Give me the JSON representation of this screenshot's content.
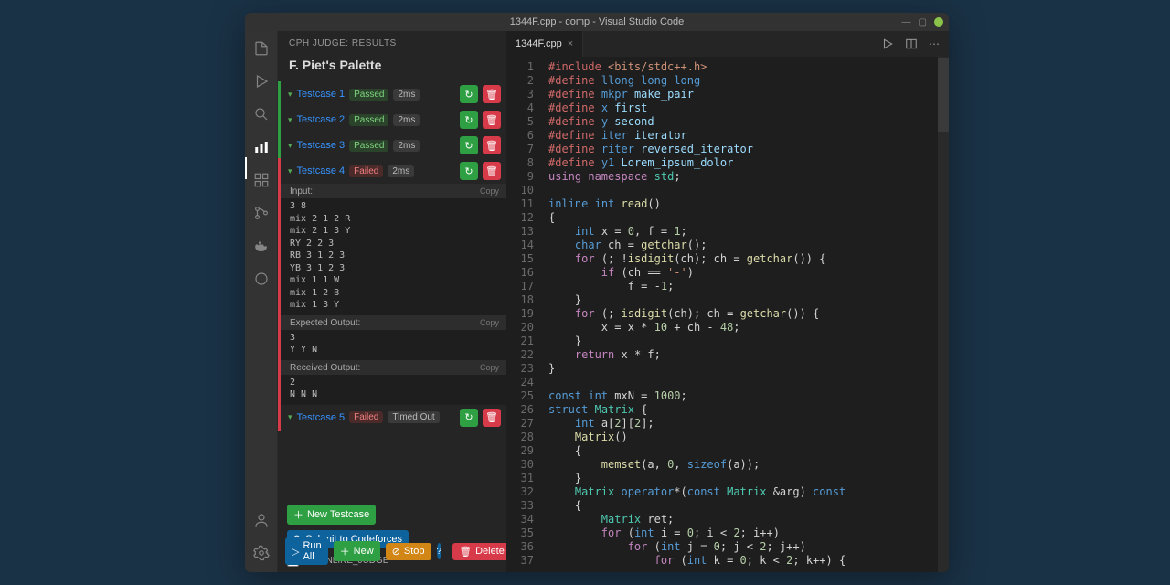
{
  "title": "1344F.cpp - comp - Visual Studio Code",
  "sidebar": {
    "header": "CPH JUDGE: RESULTS",
    "problem": "F. Piet's Palette",
    "testcases": [
      {
        "name": "Testcase 1",
        "status": "Passed",
        "time": "2ms",
        "result": "pass"
      },
      {
        "name": "Testcase 2",
        "status": "Passed",
        "time": "2ms",
        "result": "pass"
      },
      {
        "name": "Testcase 3",
        "status": "Passed",
        "time": "2ms",
        "result": "pass"
      },
      {
        "name": "Testcase 4",
        "status": "Failed",
        "time": "2ms",
        "result": "fail",
        "expanded": true,
        "input": "3 8\nmix 2 1 2 R\nmix 2 1 3 Y\nRY 2 2 3\nRB 3 1 2 3\nYB 3 1 2 3\nmix 1 1 W\nmix 1 2 B\nmix 1 3 Y",
        "expected": "3\nY Y N",
        "received": "2\nN N N"
      },
      {
        "name": "Testcase 5",
        "status": "Failed",
        "time": "Timed Out",
        "result": "fail",
        "timedout": true
      }
    ],
    "buttons": {
      "new_testcase": "New Testcase",
      "submit": "Submit to Codeforces",
      "set_online": "Set ONLINE_JUDGE",
      "run_all": "Run All",
      "new": "New",
      "stop": "Stop",
      "delete": "Delete"
    },
    "labels": {
      "input": "Input:",
      "expected": "Expected Output:",
      "received": "Received Output:",
      "copy": "Copy"
    }
  },
  "tab": {
    "name": "1344F.cpp"
  },
  "code_lines": [
    {
      "n": 1,
      "html": "<span class='m'>#include</span> <span class='s'>&lt;bits/stdc++.h&gt;</span>"
    },
    {
      "n": 2,
      "html": "<span class='m'>#define</span> <span class='c'>llong</span> <span class='c'>long</span> <span class='c'>long</span>"
    },
    {
      "n": 3,
      "html": "<span class='m'>#define</span> <span class='c'>mkpr</span> <span class='v'>make_pair</span>"
    },
    {
      "n": 4,
      "html": "<span class='m'>#define</span> <span class='c'>x</span> <span class='v'>first</span>"
    },
    {
      "n": 5,
      "html": "<span class='m'>#define</span> <span class='c'>y</span> <span class='v'>second</span>"
    },
    {
      "n": 6,
      "html": "<span class='m'>#define</span> <span class='c'>iter</span> <span class='v'>iterator</span>"
    },
    {
      "n": 7,
      "html": "<span class='m'>#define</span> <span class='c'>riter</span> <span class='v'>reversed_iterator</span>"
    },
    {
      "n": 8,
      "html": "<span class='m'>#define</span> <span class='c'>y1</span> <span class='v'>Lorem_ipsum_dolor</span>"
    },
    {
      "n": 9,
      "html": "<span class='k'>using</span> <span class='k'>namespace</span> <span class='t'>std</span>;"
    },
    {
      "n": 10,
      "html": ""
    },
    {
      "n": 11,
      "html": "<span class='c'>inline</span> <span class='c'>int</span> <span class='fn'>read</span>()"
    },
    {
      "n": 12,
      "html": "{"
    },
    {
      "n": 13,
      "html": "    <span class='c'>int</span> x = <span class='n'>0</span>, f = <span class='n'>1</span>;"
    },
    {
      "n": 14,
      "html": "    <span class='c'>char</span> ch = <span class='fn'>getchar</span>();"
    },
    {
      "n": 15,
      "html": "    <span class='k'>for</span> (; !<span class='fn'>isdigit</span>(ch); ch = <span class='fn'>getchar</span>()) {"
    },
    {
      "n": 16,
      "html": "        <span class='k'>if</span> (ch == <span class='s'>'-'</span>)"
    },
    {
      "n": 17,
      "html": "            f = -<span class='n'>1</span>;"
    },
    {
      "n": 18,
      "html": "    }"
    },
    {
      "n": 19,
      "html": "    <span class='k'>for</span> (; <span class='fn'>isdigit</span>(ch); ch = <span class='fn'>getchar</span>()) {"
    },
    {
      "n": 20,
      "html": "        x = x * <span class='n'>10</span> + ch - <span class='n'>48</span>;"
    },
    {
      "n": 21,
      "html": "    }"
    },
    {
      "n": 22,
      "html": "    <span class='k'>return</span> x * f;"
    },
    {
      "n": 23,
      "html": "}"
    },
    {
      "n": 24,
      "html": ""
    },
    {
      "n": 25,
      "html": "<span class='c'>const</span> <span class='c'>int</span> mxN = <span class='n'>1000</span>;"
    },
    {
      "n": 26,
      "html": "<span class='c'>struct</span> <span class='t'>Matrix</span> {"
    },
    {
      "n": 27,
      "html": "    <span class='c'>int</span> a[<span class='n'>2</span>][<span class='n'>2</span>];"
    },
    {
      "n": 28,
      "html": "    <span class='fn'>Matrix</span>()"
    },
    {
      "n": 29,
      "html": "    {"
    },
    {
      "n": 30,
      "html": "        <span class='fn'>memset</span>(a, <span class='n'>0</span>, <span class='c'>sizeof</span>(a));"
    },
    {
      "n": 31,
      "html": "    }"
    },
    {
      "n": 32,
      "html": "    <span class='t'>Matrix</span> <span class='c'>operator</span>*(<span class='c'>const</span> <span class='t'>Matrix</span> &amp;arg) <span class='c'>const</span>"
    },
    {
      "n": 33,
      "html": "    {"
    },
    {
      "n": 34,
      "html": "        <span class='t'>Matrix</span> ret;"
    },
    {
      "n": 35,
      "html": "        <span class='k'>for</span> (<span class='c'>int</span> i = <span class='n'>0</span>; i &lt; <span class='n'>2</span>; i++)"
    },
    {
      "n": 36,
      "html": "            <span class='k'>for</span> (<span class='c'>int</span> j = <span class='n'>0</span>; j &lt; <span class='n'>2</span>; j++)"
    },
    {
      "n": 37,
      "html": "                <span class='k'>for</span> (<span class='c'>int</span> k = <span class='n'>0</span>; k &lt; <span class='n'>2</span>; k++) {"
    }
  ]
}
